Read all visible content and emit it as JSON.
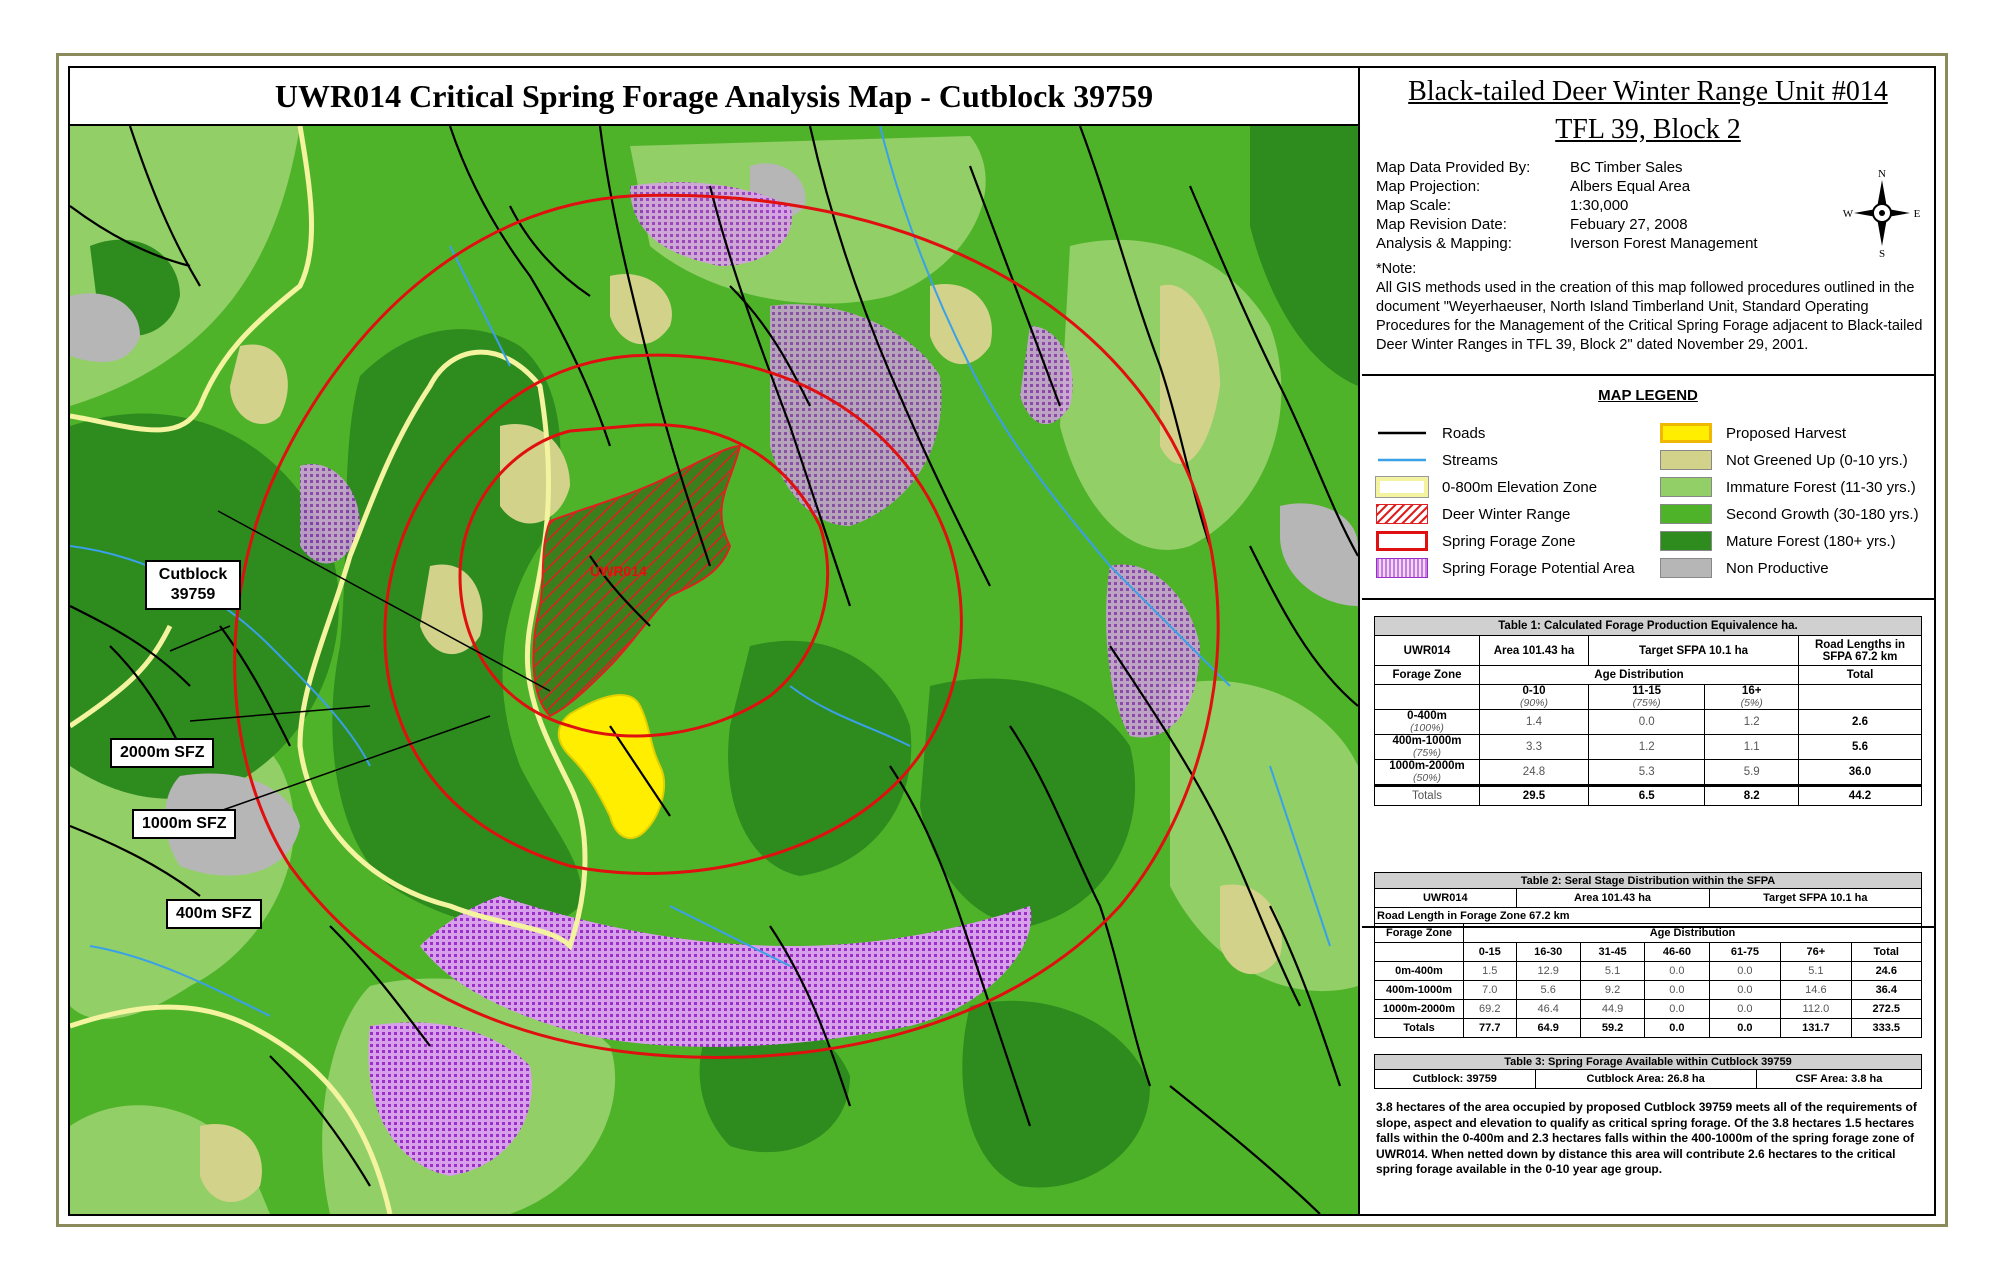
{
  "map": {
    "title": "UWR014 Critical Spring Forage Analysis Map - Cutblock 39759",
    "unit_label": "UWR014",
    "callouts": {
      "cutblock": [
        "Cutblock",
        "39759"
      ],
      "sfz_2000": "2000m SFZ",
      "sfz_1000": "1000m SFZ",
      "sfz_400": "400m SFZ"
    },
    "colors": {
      "mature": "#2e8b1e",
      "second_growth": "#4fb32a",
      "immature": "#92cf67",
      "not_greened": "#d2d28a",
      "non_productive": "#b6b6b6",
      "forage_potential": "#c87be0",
      "proposed_harvest": "#ffee00",
      "winter_range_hatch": "#e02020",
      "elevation_zone": "#f3f3a0",
      "spring_zone": "#e01010",
      "roads": "#000000",
      "streams": "#3aa0e8"
    }
  },
  "panel": {
    "title_line1": "Black-tailed Deer Winter Range Unit #014",
    "title_line2": "TFL 39, Block 2",
    "meta": [
      {
        "k": "Map Data Provided By:",
        "v": "BC Timber Sales"
      },
      {
        "k": "Map Projection:",
        "v": "Albers Equal Area"
      },
      {
        "k": "Map Scale:",
        "v": "1:30,000"
      },
      {
        "k": "Map Revision Date:",
        "v": "Febuary 27, 2008"
      },
      {
        "k": "Analysis & Mapping:",
        "v": "Iverson Forest Management"
      }
    ],
    "compass": {
      "n": "N",
      "s": "S",
      "e": "E",
      "w": "W"
    },
    "note_label": "*Note:",
    "note": "All GIS methods used in the creation of this map followed procedures outlined in the document \"Weyerhaeuser, North Island Timberland Unit, Standard Operating Procedures for the Management of the Critical Spring Forage adjacent to Black-tailed Deer Winter Ranges in TFL 39, Block 2\" dated November 29, 2001.",
    "legend_title": "MAP LEGEND",
    "legend_left": [
      "Roads",
      "Streams",
      "0-800m Elevation Zone",
      "Deer Winter Range",
      "Spring Forage Zone",
      "Spring Forage Potential Area"
    ],
    "legend_right": [
      "Proposed Harvest",
      "Not Greened Up (0-10 yrs.)",
      "Immature Forest (11-30 yrs.)",
      "Second Growth (30-180 yrs.)",
      "Mature Forest (180+ yrs.)",
      "Non Productive"
    ]
  },
  "table1": {
    "caption": "Table 1: Calculated Forage Production Equivalence ha.",
    "h_unit": "UWR014",
    "h_area": "Area 101.43 ha",
    "h_target": "Target SFPA 10.1 ha",
    "h_road": "Road Lengths in SFPA 67.2 km",
    "h_zone": "Forage Zone",
    "h_age": "Age Distribution",
    "h_total": "Total",
    "ages": [
      {
        "a": "0-10",
        "p": "(90%)"
      },
      {
        "a": "11-15",
        "p": "(75%)"
      },
      {
        "a": "16+",
        "p": "(5%)"
      }
    ],
    "rows": [
      {
        "zone": "0-400m",
        "pct": "(100%)",
        "v": [
          "1.4",
          "0.0",
          "1.2"
        ],
        "total": "2.6"
      },
      {
        "zone": "400m-1000m",
        "pct": "(75%)",
        "v": [
          "3.3",
          "1.2",
          "1.1"
        ],
        "total": "5.6"
      },
      {
        "zone": "1000m-2000m",
        "pct": "(50%)",
        "v": [
          "24.8",
          "5.3",
          "5.9"
        ],
        "total": "36.0"
      }
    ],
    "totals": {
      "label": "Totals",
      "v": [
        "29.5",
        "6.5",
        "8.2"
      ],
      "total": "44.2"
    }
  },
  "table2": {
    "caption": "Table 2: Seral Stage Distribution within the SFPA",
    "h_unit": "UWR014",
    "h_area": "Area 101.43 ha",
    "h_target": "Target SFPA 10.1 ha",
    "road": "Road Length in Forage Zone 67.2 km",
    "h_zone": "Forage Zone",
    "h_age": "Age Distribution",
    "cols": [
      "0-15",
      "16-30",
      "31-45",
      "46-60",
      "61-75",
      "76+",
      "Total"
    ],
    "rows": [
      {
        "zone": "0m-400m",
        "v": [
          "1.5",
          "12.9",
          "5.1",
          "0.0",
          "0.0",
          "5.1",
          "24.6"
        ]
      },
      {
        "zone": "400m-1000m",
        "v": [
          "7.0",
          "5.6",
          "9.2",
          "0.0",
          "0.0",
          "14.6",
          "36.4"
        ]
      },
      {
        "zone": "1000m-2000m",
        "v": [
          "69.2",
          "46.4",
          "44.9",
          "0.0",
          "0.0",
          "112.0",
          "272.5"
        ]
      }
    ],
    "totals": {
      "label": "Totals",
      "v": [
        "77.7",
        "64.9",
        "59.2",
        "0.0",
        "0.0",
        "131.7",
        "333.5"
      ]
    }
  },
  "table3": {
    "caption": "Table 3: Spring Forage Available within Cutblock 39759",
    "cells": [
      "Cutblock: 39759",
      "Cutblock Area: 26.8 ha",
      "CSF Area: 3.8 ha"
    ]
  },
  "summary": "3.8 hectares of the area occupied by proposed Cutblock 39759 meets all of the requirements of slope, aspect and elevation to qualify as critical spring forage. Of the 3.8 hectares 1.5 hectares falls within the 0-400m and 2.3 hectares falls within the 400-1000m of the spring forage zone of UWR014. When netted down by distance this area will contribute 2.6 hectares to the critical spring forage available in the 0-10 year age group."
}
